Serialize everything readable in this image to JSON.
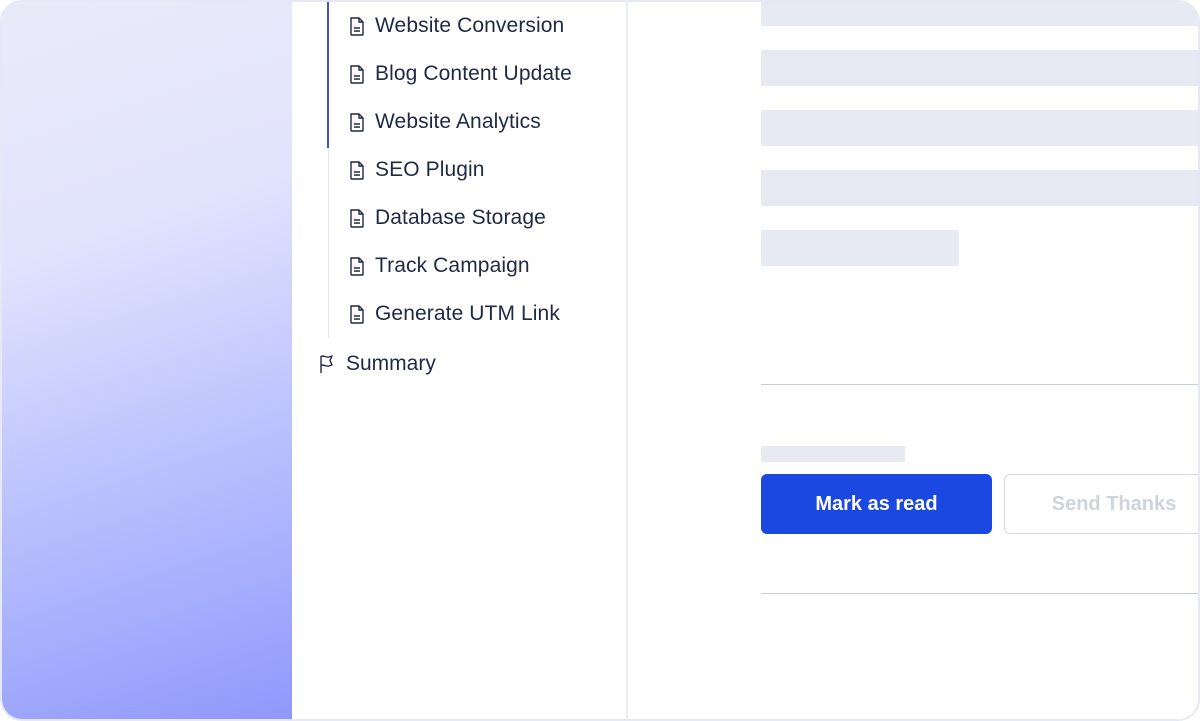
{
  "nav": {
    "items": [
      {
        "label": "Website Conversion",
        "icon": "document-icon"
      },
      {
        "label": "Blog Content Update",
        "icon": "document-icon"
      },
      {
        "label": "Website Analytics",
        "icon": "document-icon"
      },
      {
        "label": "SEO Plugin",
        "icon": "document-icon"
      },
      {
        "label": "Database Storage",
        "icon": "document-icon"
      },
      {
        "label": "Track Campaign",
        "icon": "document-icon"
      },
      {
        "label": "Generate UTM Link",
        "icon": "document-icon"
      }
    ],
    "summary": {
      "label": "Summary",
      "icon": "flag-icon"
    }
  },
  "actions": {
    "mark_read_label": "Mark as read",
    "send_thanks_label": "Send Thanks"
  },
  "colors": {
    "accent": "#1a48e0",
    "active_indicator": "#4453c9",
    "text": "#1e2a44",
    "skeleton": "#e7eaf3"
  }
}
